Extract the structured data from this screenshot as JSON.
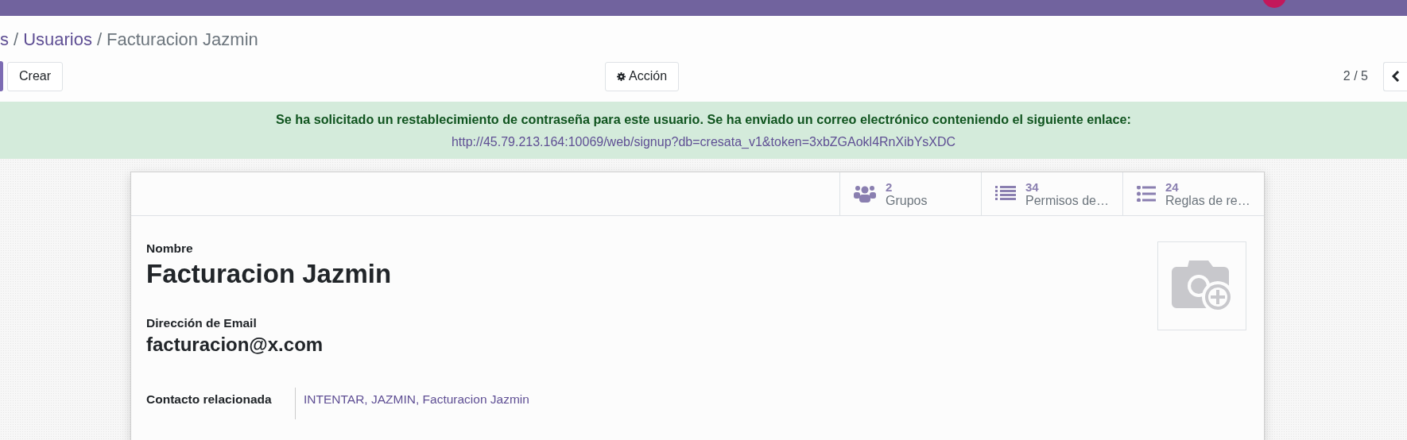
{
  "breadcrumb": [
    {
      "label": "s",
      "link": true
    },
    {
      "separator": "/",
      "label": "Usuarios",
      "link": true
    },
    {
      "separator": "/",
      "label": "Facturacion Jazmin",
      "link": false
    }
  ],
  "toolbar": {
    "create": "Crear",
    "action": "Acción",
    "pager": "2 / 5"
  },
  "alert": {
    "message": "Se ha solicitado un restablecimiento de contraseña para este usuario. Se ha enviado un correo electrónico conteniendo el siguiente enlace:",
    "link": "http://45.79.213.164:10069/web/signup?db=cresata_v1&token=3xbZGAokl4RnXibYsXDC"
  },
  "stat_buttons": [
    {
      "kind": "groups",
      "value": "2",
      "label": "Grupos"
    },
    {
      "kind": "list",
      "value": "34",
      "label": "Permisos de…"
    },
    {
      "kind": "bullets",
      "value": "24",
      "label": "Reglas de re…"
    }
  ],
  "form": {
    "name_label": "Nombre",
    "name": "Facturacion Jazmin",
    "email_label": "Dirección de Email",
    "email": "facturacion@x.com",
    "contact_label": "Contacto relacionada",
    "contact": "INTENTAR, JAZMIN, Facturacion Jazmin"
  }
}
